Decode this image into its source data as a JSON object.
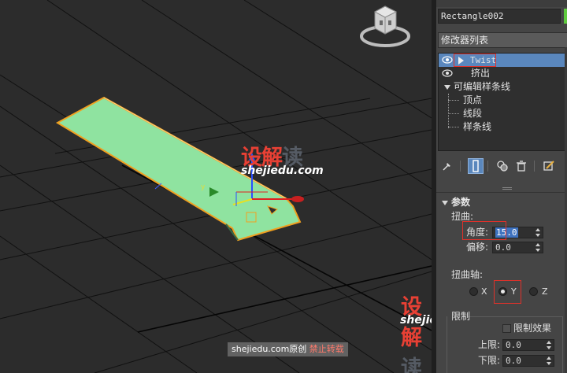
{
  "viewport": {
    "watermark_url": "shejiedu.com",
    "watermark_cn_main": "设解",
    "watermark_cn_tail": "读",
    "footer_prefix": "shejiedu.com原创 ",
    "footer_warning": "禁止转载",
    "colors": {
      "shape_fill": "#8fe3a0",
      "shape_outline": "#f0a020",
      "grid": "#0e0e0e",
      "background": "#2c2c2c"
    }
  },
  "panel": {
    "object_name": "Rectangle002",
    "object_color": "#5fca3e",
    "modifier_list_label": "修改器列表",
    "stack": [
      {
        "label": "Twist",
        "selected": true
      },
      {
        "label": "挤出",
        "selected": false
      },
      {
        "label": "可编辑样条线",
        "selected": false
      },
      {
        "label": "顶点",
        "selected": false
      },
      {
        "label": "线段",
        "selected": false
      },
      {
        "label": "样条线",
        "selected": false
      }
    ],
    "toolbar_icons": [
      "pin-stack-icon",
      "show-end-result-icon",
      "make-unique-icon",
      "remove-modifier-icon",
      "configure-modifier-sets-icon"
    ],
    "parameters": {
      "rollout_title": "参数",
      "twist_group": "扭曲:",
      "angle_label": "角度:",
      "angle_value": "15.0",
      "bias_label": "偏移:",
      "bias_value": "0.0",
      "axis_group": "扭曲轴:",
      "axis_options": [
        "X",
        "Y",
        "Z"
      ],
      "axis_selected": "Y",
      "limits_group": "限制",
      "limit_effect_label": "限制效果",
      "upper_label": "上限:",
      "upper_value": "0.0",
      "lower_label": "下限:",
      "lower_value": "0.0"
    }
  }
}
